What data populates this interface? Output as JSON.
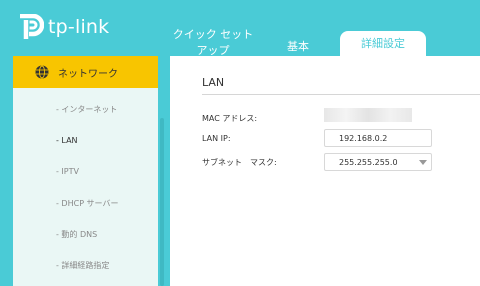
{
  "logo": {
    "text": "tp-link"
  },
  "tabs": {
    "quick_setup": "クイック セット\nアップ",
    "basic": "基本",
    "advanced": "詳細設定"
  },
  "sidebar": {
    "active_label": "ネットワーク",
    "items": [
      {
        "label": "- インターネット"
      },
      {
        "label": "- LAN"
      },
      {
        "label": "- IPTV"
      },
      {
        "label": "- DHCP サーバー"
      },
      {
        "label": "- 動的 DNS"
      },
      {
        "label": "- 詳細経路指定"
      }
    ]
  },
  "main": {
    "section_title": "LAN",
    "mac_label": "MAC アドレス:",
    "lan_ip_label": "LAN IP:",
    "lan_ip_value": "192.168.0.2",
    "subnet_label": "サブネット　マスク:",
    "subnet_value": "255.255.255.0"
  },
  "colors": {
    "header": "#4acbd6",
    "accent": "#f8c500",
    "sidebar_bg": "#eaf7f5"
  }
}
